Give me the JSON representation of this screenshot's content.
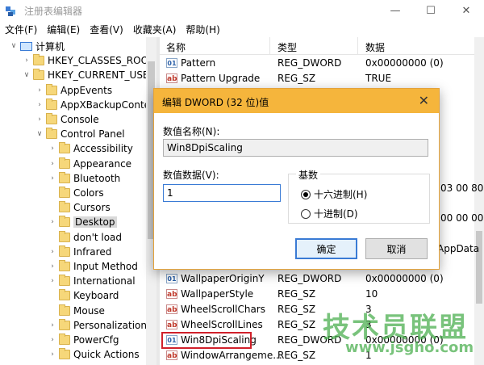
{
  "window": {
    "title": "注册表编辑器",
    "controls": {
      "minimize": "—",
      "maximize": "☐",
      "close": "✕"
    }
  },
  "menu": [
    "文件(F)",
    "编辑(E)",
    "查看(V)",
    "收藏夹(A)",
    "帮助(H)"
  ],
  "tree": {
    "items": [
      {
        "label": "计算机",
        "chevron": "∨",
        "icon": "computer-icon"
      },
      {
        "label": "HKEY_CLASSES_ROOT",
        "chevron": "›",
        "icon": "folder-icon"
      },
      {
        "label": "HKEY_CURRENT_USER",
        "chevron": "∨",
        "icon": "folder-icon"
      },
      {
        "label": "AppEvents",
        "chevron": "›",
        "icon": "folder-icon"
      },
      {
        "label": "AppXBackupConter",
        "chevron": "›",
        "icon": "folder-icon"
      },
      {
        "label": "Console",
        "chevron": "›",
        "icon": "folder-icon"
      },
      {
        "label": "Control Panel",
        "chevron": "∨",
        "icon": "folder-icon"
      },
      {
        "label": "Accessibility",
        "chevron": "›",
        "icon": "folder-icon"
      },
      {
        "label": "Appearance",
        "chevron": "›",
        "icon": "folder-icon"
      },
      {
        "label": "Bluetooth",
        "chevron": "›",
        "icon": "folder-icon"
      },
      {
        "label": "Colors",
        "chevron": "",
        "icon": "folder-icon"
      },
      {
        "label": "Cursors",
        "chevron": "",
        "icon": "folder-icon"
      },
      {
        "label": "Desktop",
        "chevron": "›",
        "icon": "folder-icon",
        "selected": true
      },
      {
        "label": "don't load",
        "chevron": "",
        "icon": "folder-icon"
      },
      {
        "label": "Infrared",
        "chevron": "›",
        "icon": "folder-icon"
      },
      {
        "label": "Input Method",
        "chevron": "›",
        "icon": "folder-icon"
      },
      {
        "label": "International",
        "chevron": "›",
        "icon": "folder-icon"
      },
      {
        "label": "Keyboard",
        "chevron": "",
        "icon": "folder-icon"
      },
      {
        "label": "Mouse",
        "chevron": "",
        "icon": "folder-icon"
      },
      {
        "label": "Personalization",
        "chevron": "›",
        "icon": "folder-icon"
      },
      {
        "label": "PowerCfg",
        "chevron": "›",
        "icon": "folder-icon"
      },
      {
        "label": "Quick Actions",
        "chevron": "›",
        "icon": "folder-icon"
      }
    ]
  },
  "list": {
    "columns": [
      "名称",
      "类型",
      "数据"
    ],
    "rows": [
      {
        "icon": "binary-icon",
        "glyph": "01",
        "name": "Pattern",
        "type": "REG_DWORD",
        "data": "0x00000000 (0)"
      },
      {
        "icon": "string-icon",
        "glyph": "ab",
        "name": "Pattern Upgrade",
        "type": "REG_SZ",
        "data": "TRUE"
      },
      {
        "icon": "binary-icon",
        "glyph": "01",
        "name": "WallpaperOriginY",
        "type": "REG_DWORD",
        "data": "0x00000000 (0)"
      },
      {
        "icon": "string-icon",
        "glyph": "ab",
        "name": "WallpaperStyle",
        "type": "REG_SZ",
        "data": "10"
      },
      {
        "icon": "string-icon",
        "glyph": "ab",
        "name": "WheelScrollChars",
        "type": "REG_SZ",
        "data": "3"
      },
      {
        "icon": "string-icon",
        "glyph": "ab",
        "name": "WheelScrollLines",
        "type": "REG_SZ",
        "data": "3"
      },
      {
        "icon": "binary-icon",
        "glyph": "01",
        "name": "Win8DpiScaling",
        "type": "REG_DWORD",
        "data": "0x00000000 (0)",
        "highlighted": true
      },
      {
        "icon": "string-icon",
        "glyph": "ab",
        "name": "WindowArrangeme...",
        "type": "REG_SZ",
        "data": "1"
      }
    ],
    "peek": [
      "03 00 80",
      "00 00 00",
      "AppData"
    ]
  },
  "dialog": {
    "title": "编辑 DWORD (32 位)值",
    "value_name_label": "数值名称(N):",
    "value_name": "Win8DpiScaling",
    "value_data_label": "数值数据(V):",
    "value_data": "1",
    "base_label": "基数",
    "radio_hex": "十六进制(H)",
    "radio_dec": "十进制(D)",
    "selected_base": "hex",
    "ok": "确定",
    "cancel": "取消"
  },
  "watermark": {
    "text": "技术员联盟",
    "url": "www.jsgho.com"
  }
}
